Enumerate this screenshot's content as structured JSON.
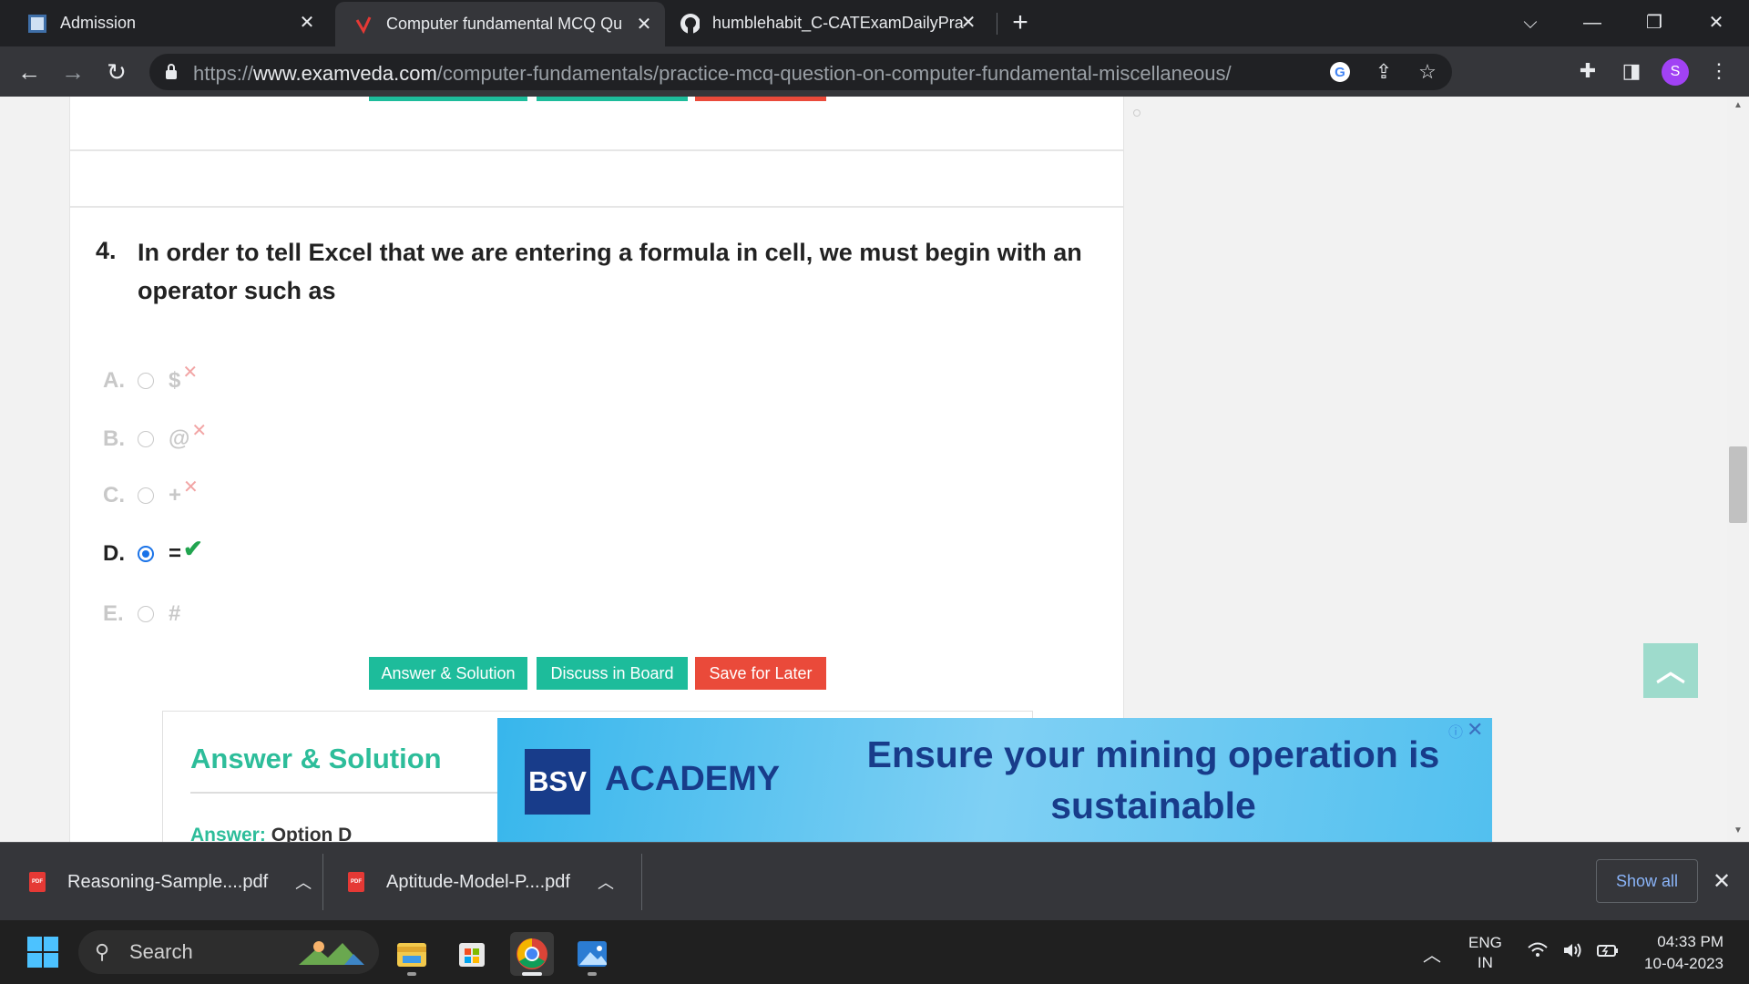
{
  "browser": {
    "tabs": [
      {
        "title": "Admission",
        "icon": "site-favicon"
      },
      {
        "title": "Computer fundamental MCQ Qu",
        "icon": "examveda-favicon"
      },
      {
        "title": "humblehabit_C-CATExamDailyPra",
        "icon": "github-icon"
      }
    ],
    "url_prefix": "https://",
    "url_host": "www.examveda.com",
    "url_path": "/computer-fundamentals/practice-mcq-question-on-computer-fundamental-miscellaneous/",
    "profile_initial": "S"
  },
  "page": {
    "question_number": "4.",
    "question_text": "In order to tell Excel that we are entering a formula in cell, we must begin with an operator such as",
    "options": [
      {
        "letter": "A.",
        "value": "$",
        "mark": "✕"
      },
      {
        "letter": "B.",
        "value": "@",
        "mark": "✕"
      },
      {
        "letter": "C.",
        "value": "+",
        "mark": "✕"
      },
      {
        "letter": "D.",
        "value": "=",
        "mark": "✔"
      },
      {
        "letter": "E.",
        "value": "#",
        "mark": ""
      }
    ],
    "buttons": {
      "answer": "Answer & Solution",
      "discuss": "Discuss in Board",
      "save": "Save for Later"
    },
    "solution": {
      "title": "Answer & Solution",
      "answer_label": "Answer:",
      "answer_value": "Option D"
    },
    "ad": {
      "logo": "BSV",
      "brand": "ACADEMY",
      "text": "Ensure your mining operation is sustainable"
    },
    "colors": {
      "accent": "#1dbc9b",
      "danger": "#ea4a3a",
      "ad_navy": "#183c8a"
    }
  },
  "downloads": {
    "items": [
      {
        "name": "Reasoning-Sample....pdf"
      },
      {
        "name": "Aptitude-Model-P....pdf"
      }
    ],
    "show_all": "Show all"
  },
  "taskbar": {
    "search_placeholder": "Search",
    "lang_line1": "ENG",
    "lang_line2": "IN",
    "time": "04:33 PM",
    "date": "10-04-2023"
  }
}
